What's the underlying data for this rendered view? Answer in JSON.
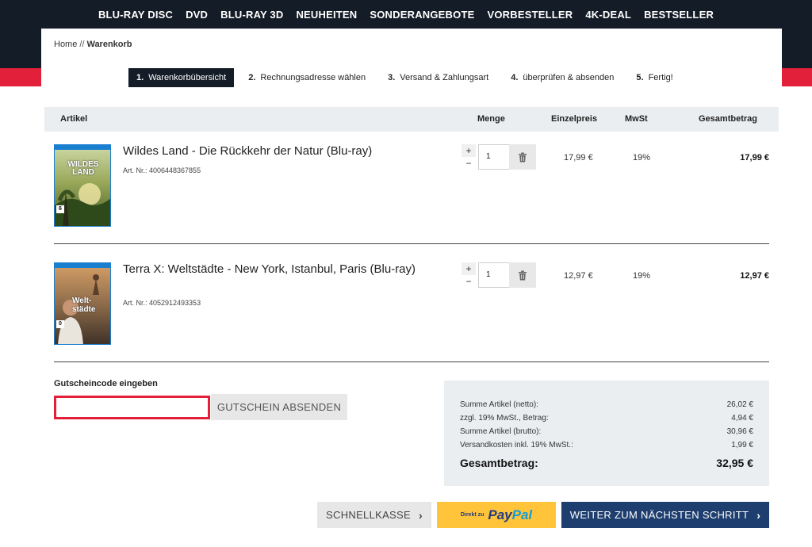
{
  "nav": [
    {
      "label": "BLU-RAY DISC"
    },
    {
      "label": "DVD"
    },
    {
      "label": "BLU-RAY 3D"
    },
    {
      "label": "NEUHEITEN"
    },
    {
      "label": "SONDERANGEBOTE"
    },
    {
      "label": "VORBESTELLER"
    },
    {
      "label": "4K-DEAL"
    },
    {
      "label": "BESTSELLER"
    }
  ],
  "breadcrumb": {
    "home": "Home",
    "separator": "//",
    "current": "Warenkorb"
  },
  "steps": [
    {
      "num": "1.",
      "label": "Warenkorbübersicht",
      "active": true
    },
    {
      "num": "2.",
      "label": "Rechnungsadresse wählen"
    },
    {
      "num": "3.",
      "label": "Versand & Zahlungsart"
    },
    {
      "num": "4.",
      "label": "überprüfen & absenden"
    },
    {
      "num": "5.",
      "label": "Fertig!"
    }
  ],
  "table_header": {
    "article": "Artikel",
    "quantity": "Menge",
    "unit_price": "Einzelpreis",
    "vat": "MwSt",
    "total": "Gesamtbetrag"
  },
  "items": [
    {
      "title": "Wildes Land - Die Rückkehr der Natur (Blu-ray)",
      "art_nr": "Art. Nr.: 4006448367855",
      "quantity": "1",
      "unit_price": "17,99 €",
      "vat": "19%",
      "total": "17,99 €",
      "cover_text": "WILDES LAND",
      "cover_badge": "6"
    },
    {
      "title": "Terra X: Weltstädte - New York, Istanbul, Paris (Blu-ray)",
      "art_nr": "Art. Nr.: 4052912493353",
      "quantity": "1",
      "unit_price": "12,97 €",
      "vat": "19%",
      "total": "12,97 €",
      "cover_text": "Welt-städte",
      "cover_badge": "0"
    }
  ],
  "qty_controls": {
    "plus": "+",
    "minus": "−"
  },
  "voucher": {
    "label": "Gutscheincode eingeben",
    "value": "",
    "button": "GUTSCHEIN ABSENDEN"
  },
  "summary": {
    "lines": [
      {
        "label": "Summe Artikel (netto):",
        "value": "26,02 €"
      },
      {
        "label": "zzgl. 19% MwSt., Betrag:",
        "value": "4,94 €"
      },
      {
        "label": "Summe Artikel (brutto):",
        "value": "30,96 €"
      },
      {
        "label": "Versandkosten inkl. 19% MwSt.:",
        "value": "1,99 €"
      }
    ],
    "total_label": "Gesamtbetrag:",
    "total_value": "32,95 €"
  },
  "buttons": {
    "quick_checkout": "SCHNELLKASSE",
    "paypal_prefix": "Direkt zu",
    "paypal_pay": "Pay",
    "paypal_pal": "Pal",
    "next": "WEITER ZUM NÄCHSTEN SCHRITT",
    "chevron": "›"
  },
  "colors": {
    "header_dark": "#141c27",
    "accent_red": "#e3203a",
    "next_blue": "#1d3e6e",
    "paypal_yellow": "#ffc439"
  }
}
